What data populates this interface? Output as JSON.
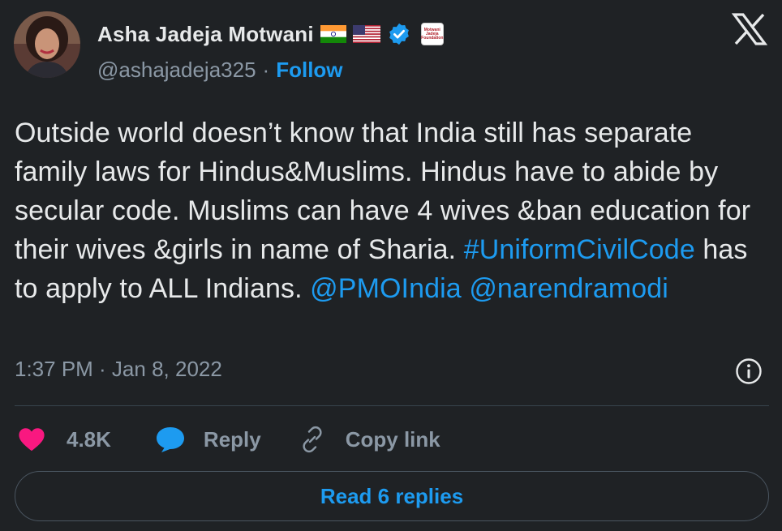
{
  "author": {
    "display_name": "Asha Jadeja Motwani",
    "handle": "@ashajadeja325",
    "separator": "·",
    "follow_label": "Follow",
    "badges": [
      "india-flag-icon",
      "usa-flag-icon",
      "verified-icon"
    ],
    "affiliation_badge_text": [
      "Motwani",
      "Jadeja",
      "Foundation"
    ],
    "verified_color": "#1d9bf0"
  },
  "tweet": {
    "segments": [
      {
        "text": "Outside world doesn’t know that India still has separate family laws for Hindus&Muslims. Hindus have to abide by secular code. Muslims can have 4 wives &ban education for their wives &girls in name of Sharia. ",
        "link": false
      },
      {
        "text": "#UniformCivilCode",
        "link": true
      },
      {
        "text": " has to apply to ALL Indians. ",
        "link": false
      },
      {
        "text": "@PMOIndia",
        "link": true
      },
      {
        "text": " ",
        "link": false
      },
      {
        "text": "@narendramodi",
        "link": true
      }
    ],
    "timestamp": "1:37 PM · Jan 8, 2022"
  },
  "actions": {
    "like_count": "4.8K",
    "reply_label": "Reply",
    "copy_link_label": "Copy link"
  },
  "read_replies_label": "Read 6 replies",
  "colors": {
    "background": "#1f2225",
    "text": "#e7e9ea",
    "muted": "#8b98a5",
    "link": "#1d9bf0",
    "like": "#f91880"
  },
  "icons": {
    "logo": "x-logo-icon",
    "info": "info-icon",
    "like": "heart-icon",
    "reply": "speech-bubble-icon",
    "copy": "link-icon"
  }
}
